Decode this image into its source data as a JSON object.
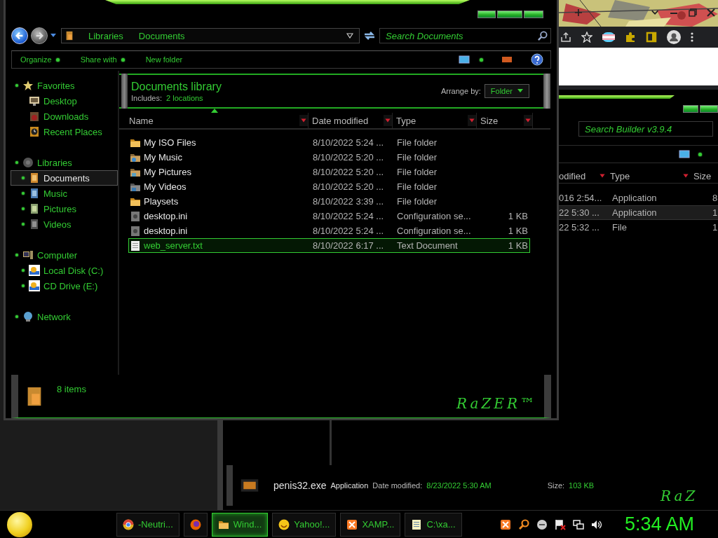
{
  "explorer": {
    "address": {
      "crumbs": [
        "Libraries",
        "Documents"
      ]
    },
    "search": {
      "placeholder": "Search Documents"
    },
    "toolbar": [
      {
        "label": "Organize",
        "has_menu": true
      },
      {
        "label": "Share with",
        "has_menu": true
      },
      {
        "label": "New folder",
        "has_menu": false
      }
    ],
    "nav": [
      {
        "label": "Favorites",
        "kind": "star",
        "selected": false,
        "expandable": true,
        "children": [
          {
            "label": "Desktop",
            "kind": "desktop",
            "selected": false,
            "expandable": false
          },
          {
            "label": "Downloads",
            "kind": "downloads",
            "selected": false,
            "expandable": false
          },
          {
            "label": "Recent Places",
            "kind": "recent",
            "selected": false,
            "expandable": false
          }
        ]
      },
      {
        "label": "Libraries",
        "kind": "libraries",
        "selected": false,
        "expandable": true,
        "children": [
          {
            "label": "Documents",
            "kind": "documents",
            "selected": true,
            "expandable": true
          },
          {
            "label": "Music",
            "kind": "music",
            "selected": false,
            "expandable": true
          },
          {
            "label": "Pictures",
            "kind": "pictures",
            "selected": false,
            "expandable": true
          },
          {
            "label": "Videos",
            "kind": "videos",
            "selected": false,
            "expandable": true
          }
        ]
      },
      {
        "label": "Computer",
        "kind": "computer",
        "selected": false,
        "expandable": true,
        "children": [
          {
            "label": "Local Disk (C:)",
            "kind": "drive",
            "selected": false,
            "expandable": true
          },
          {
            "label": "CD Drive (E:)",
            "kind": "drive",
            "selected": false,
            "expandable": true
          }
        ]
      },
      {
        "label": "Network",
        "kind": "network",
        "selected": false,
        "expandable": true
      }
    ],
    "library": {
      "title": "Documents library",
      "includes_label": "Includes:",
      "includes_link": "2 locations",
      "arrange_label": "Arrange by:",
      "arrange_value": "Folder"
    },
    "columns": [
      {
        "label": "Name",
        "sorted": true
      },
      {
        "label": "Date modified",
        "sorted": false
      },
      {
        "label": "Type",
        "sorted": false
      },
      {
        "label": "Size",
        "sorted": false
      }
    ],
    "rows": [
      {
        "name": "My ISO Files",
        "kind": "folder",
        "date": "8/10/2022 5:24 ...",
        "type": "File folder",
        "selected": false
      },
      {
        "name": "My Music",
        "kind": "music-folder",
        "date": "8/10/2022 5:20 ...",
        "type": "File folder",
        "selected": false
      },
      {
        "name": "My Pictures",
        "kind": "pictures-folder",
        "date": "8/10/2022 5:20 ...",
        "type": "File folder",
        "selected": false
      },
      {
        "name": "My Videos",
        "kind": "videos-folder",
        "date": "8/10/2022 5:20 ...",
        "type": "File folder",
        "selected": false
      },
      {
        "name": "Playsets",
        "kind": "folder",
        "date": "8/10/2022 3:39 ...",
        "type": "File folder",
        "selected": false
      },
      {
        "name": "desktop.ini",
        "kind": "gearfile",
        "date": "8/10/2022 5:24 ...",
        "type": "Configuration se...",
        "size": "1 KB",
        "selected": false
      },
      {
        "name": "desktop.ini",
        "kind": "gearfile",
        "date": "8/10/2022 5:24 ...",
        "type": "Configuration se...",
        "size": "1 KB",
        "selected": false
      },
      {
        "name": "web_server.txt",
        "kind": "textfile",
        "date": "8/10/2022 6:17 ...",
        "type": "Text Document",
        "size": "1 KB",
        "selected": true
      }
    ],
    "status": "8 items",
    "logo": "RaZER™"
  },
  "back_window": {
    "search": {
      "placeholder": "Search Builder v3.9.4"
    },
    "columns": [
      {
        "label": "odified"
      },
      {
        "label": "Type"
      },
      {
        "label": "Size"
      }
    ],
    "rows": [
      {
        "date": "016 2:54...",
        "type": "Application",
        "size": "8",
        "selected": false
      },
      {
        "date": "22 5:30 ...",
        "type": "Application",
        "size": "1",
        "selected": true
      },
      {
        "date": "22 5:32 ...",
        "type": "File",
        "size": "1",
        "selected": false
      }
    ],
    "details": {
      "name": "penis32.exe",
      "type": "Application",
      "date_label": "Date modified:",
      "date": "8/23/2022 5:30 AM",
      "size_label": "Size:",
      "size": "103 KB"
    },
    "logo": "RaZ"
  },
  "taskbar": {
    "tasks": [
      {
        "kind": "chrome",
        "label": "-Neutri...",
        "selected": false
      },
      {
        "kind": "firefox",
        "selected": false
      },
      {
        "kind": "folder",
        "label": "Wind...",
        "selected": true
      },
      {
        "kind": "yahoo",
        "label": "Yahoo!...",
        "selected": false
      },
      {
        "kind": "xampp",
        "label": "XAMP...",
        "selected": false
      },
      {
        "kind": "notepad",
        "label": "C:\\xa...",
        "selected": false
      }
    ],
    "clock": "5:34 AM"
  }
}
